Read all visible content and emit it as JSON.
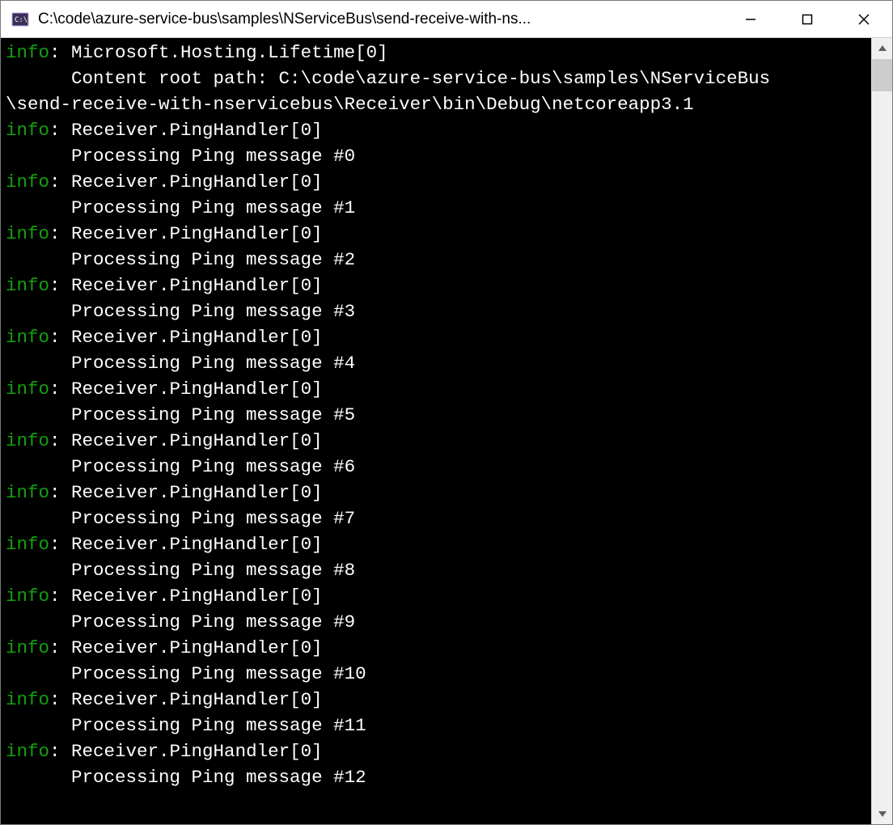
{
  "window": {
    "title": "C:\\code\\azure-service-bus\\samples\\NServiceBus\\send-receive-with-ns..."
  },
  "colors": {
    "log_level_info": "#13a10e",
    "console_bg": "#000000",
    "console_fg": "#ffffff"
  },
  "log_prefix": "info",
  "log_separator": ": ",
  "entries": [
    {
      "source": "Microsoft.Hosting.Lifetime[0]",
      "message_lines": [
        "Content root path: C:\\code\\azure-service-bus\\samples\\NServiceBus",
        "\\send-receive-with-nservicebus\\Receiver\\bin\\Debug\\netcoreapp3.1"
      ],
      "wrapped_second_line_no_indent": true
    },
    {
      "source": "Receiver.PingHandler[0]",
      "message_lines": [
        "Processing Ping message #0"
      ]
    },
    {
      "source": "Receiver.PingHandler[0]",
      "message_lines": [
        "Processing Ping message #1"
      ]
    },
    {
      "source": "Receiver.PingHandler[0]",
      "message_lines": [
        "Processing Ping message #2"
      ]
    },
    {
      "source": "Receiver.PingHandler[0]",
      "message_lines": [
        "Processing Ping message #3"
      ]
    },
    {
      "source": "Receiver.PingHandler[0]",
      "message_lines": [
        "Processing Ping message #4"
      ]
    },
    {
      "source": "Receiver.PingHandler[0]",
      "message_lines": [
        "Processing Ping message #5"
      ]
    },
    {
      "source": "Receiver.PingHandler[0]",
      "message_lines": [
        "Processing Ping message #6"
      ]
    },
    {
      "source": "Receiver.PingHandler[0]",
      "message_lines": [
        "Processing Ping message #7"
      ]
    },
    {
      "source": "Receiver.PingHandler[0]",
      "message_lines": [
        "Processing Ping message #8"
      ]
    },
    {
      "source": "Receiver.PingHandler[0]",
      "message_lines": [
        "Processing Ping message #9"
      ]
    },
    {
      "source": "Receiver.PingHandler[0]",
      "message_lines": [
        "Processing Ping message #10"
      ]
    },
    {
      "source": "Receiver.PingHandler[0]",
      "message_lines": [
        "Processing Ping message #11"
      ]
    },
    {
      "source": "Receiver.PingHandler[0]",
      "message_lines": [
        "Processing Ping message #12"
      ]
    }
  ]
}
